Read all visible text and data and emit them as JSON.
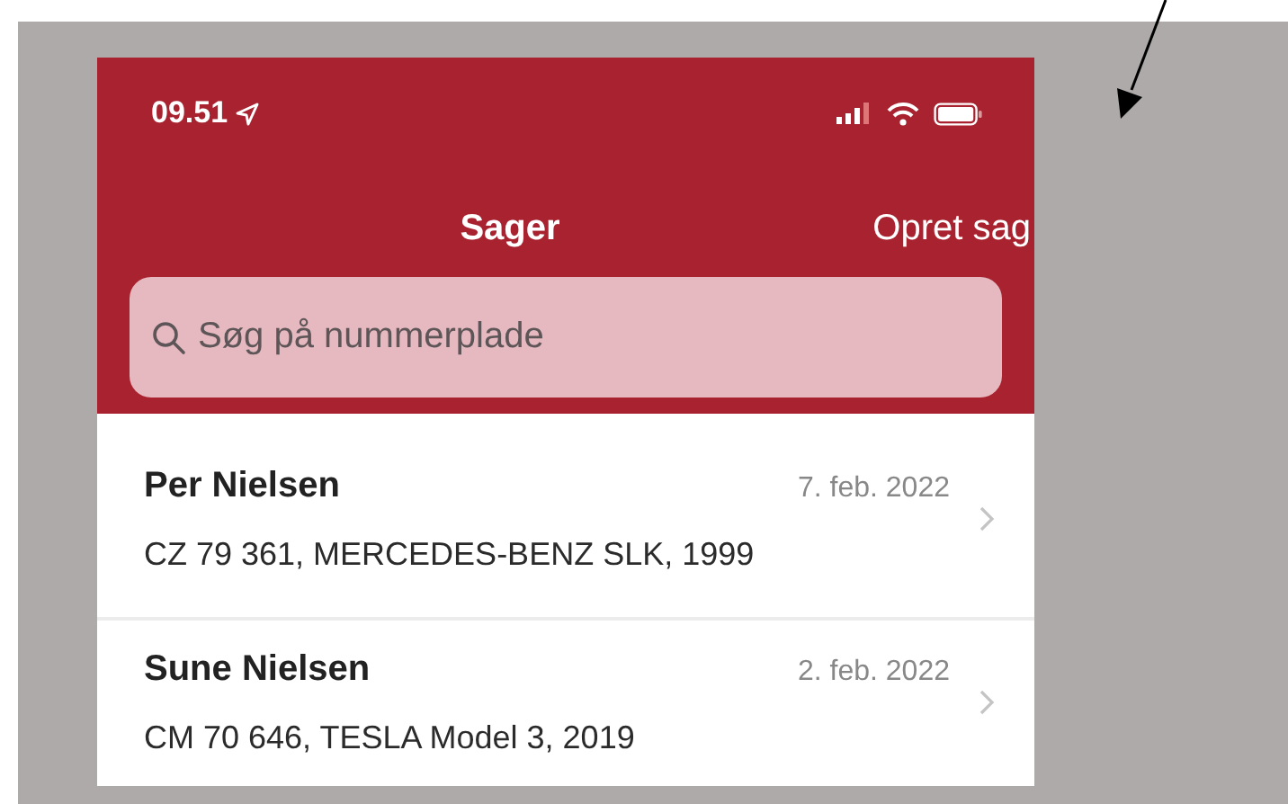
{
  "status_bar": {
    "time": "09.51"
  },
  "nav": {
    "title": "Sager",
    "action": "Opret sag"
  },
  "search": {
    "placeholder": "Søg på nummerplade"
  },
  "cases": [
    {
      "name": "Per Nielsen",
      "date": "7. feb. 2022",
      "details": "CZ 79 361, MERCEDES-BENZ SLK, 1999"
    },
    {
      "name": "Sune Nielsen",
      "date": "2. feb. 2022",
      "details": "CM 70 646, TESLA Model 3, 2019"
    }
  ]
}
